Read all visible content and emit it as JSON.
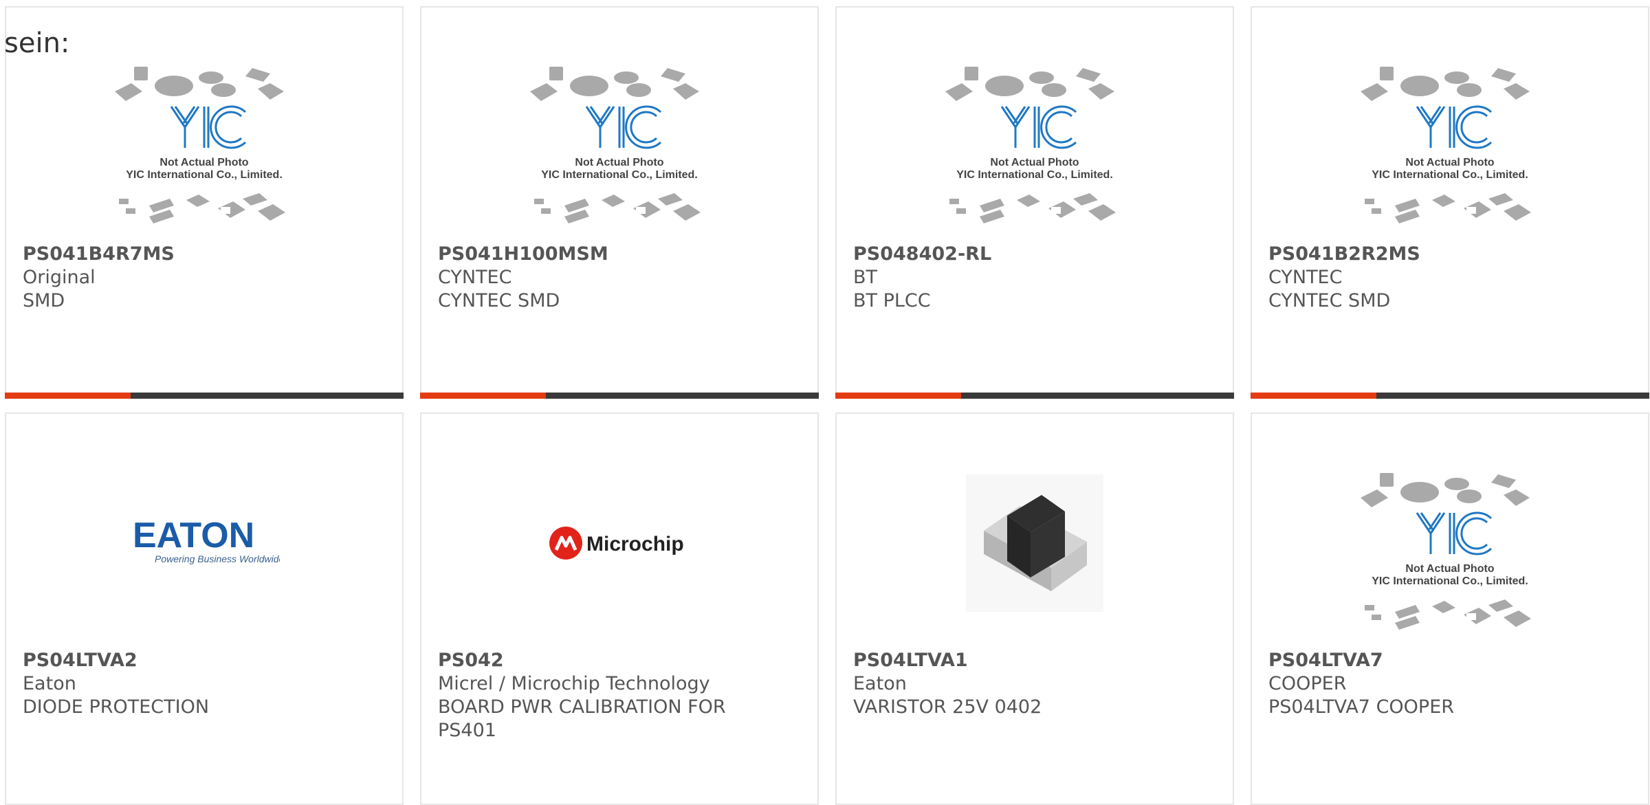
{
  "page_fragment": "sein:",
  "colors": {
    "accent_bar": "#e43c12",
    "bar_dark": "#3a3a3a",
    "card_border": "#e6e6e6",
    "text": "#555555",
    "yic_logo": "#1f78c4",
    "eaton_blue": "#1a5ca8",
    "microchip_red": "#e2231a"
  },
  "placeholder_image": {
    "caption_line1": "Not Actual Photo",
    "caption_line2": "YIC International Co., Limited."
  },
  "products": [
    {
      "part": "PS041B4R7MS",
      "manufacturer": "Original",
      "description": "SMD",
      "image": "yic-placeholder"
    },
    {
      "part": "PS041H100MSM",
      "manufacturer": "CYNTEC",
      "description": "CYNTEC SMD",
      "image": "yic-placeholder"
    },
    {
      "part": "PS048402-RL",
      "manufacturer": "BT",
      "description": "BT PLCC",
      "image": "yic-placeholder"
    },
    {
      "part": "PS041B2R2MS",
      "manufacturer": "CYNTEC",
      "description": "CYNTEC SMD",
      "image": "yic-placeholder"
    },
    {
      "part": "PS04LTVA2",
      "manufacturer": "Eaton",
      "description": "DIODE PROTECTION",
      "image": "eaton-logo",
      "logo_text": "EATON",
      "logo_tagline": "Powering Business Worldwide"
    },
    {
      "part": "PS042",
      "manufacturer": "Micrel / Microchip Technology",
      "description": "BOARD PWR CALIBRATION FOR PS401",
      "image": "microchip-logo",
      "logo_text": "Microchip"
    },
    {
      "part": "PS04LTVA1",
      "manufacturer": "Eaton",
      "description": "VARISTOR 25V 0402",
      "image": "smd-chip-photo"
    },
    {
      "part": "PS04LTVA7",
      "manufacturer": "COOPER",
      "description": "PS04LTVA7 COOPER",
      "image": "yic-placeholder"
    }
  ]
}
